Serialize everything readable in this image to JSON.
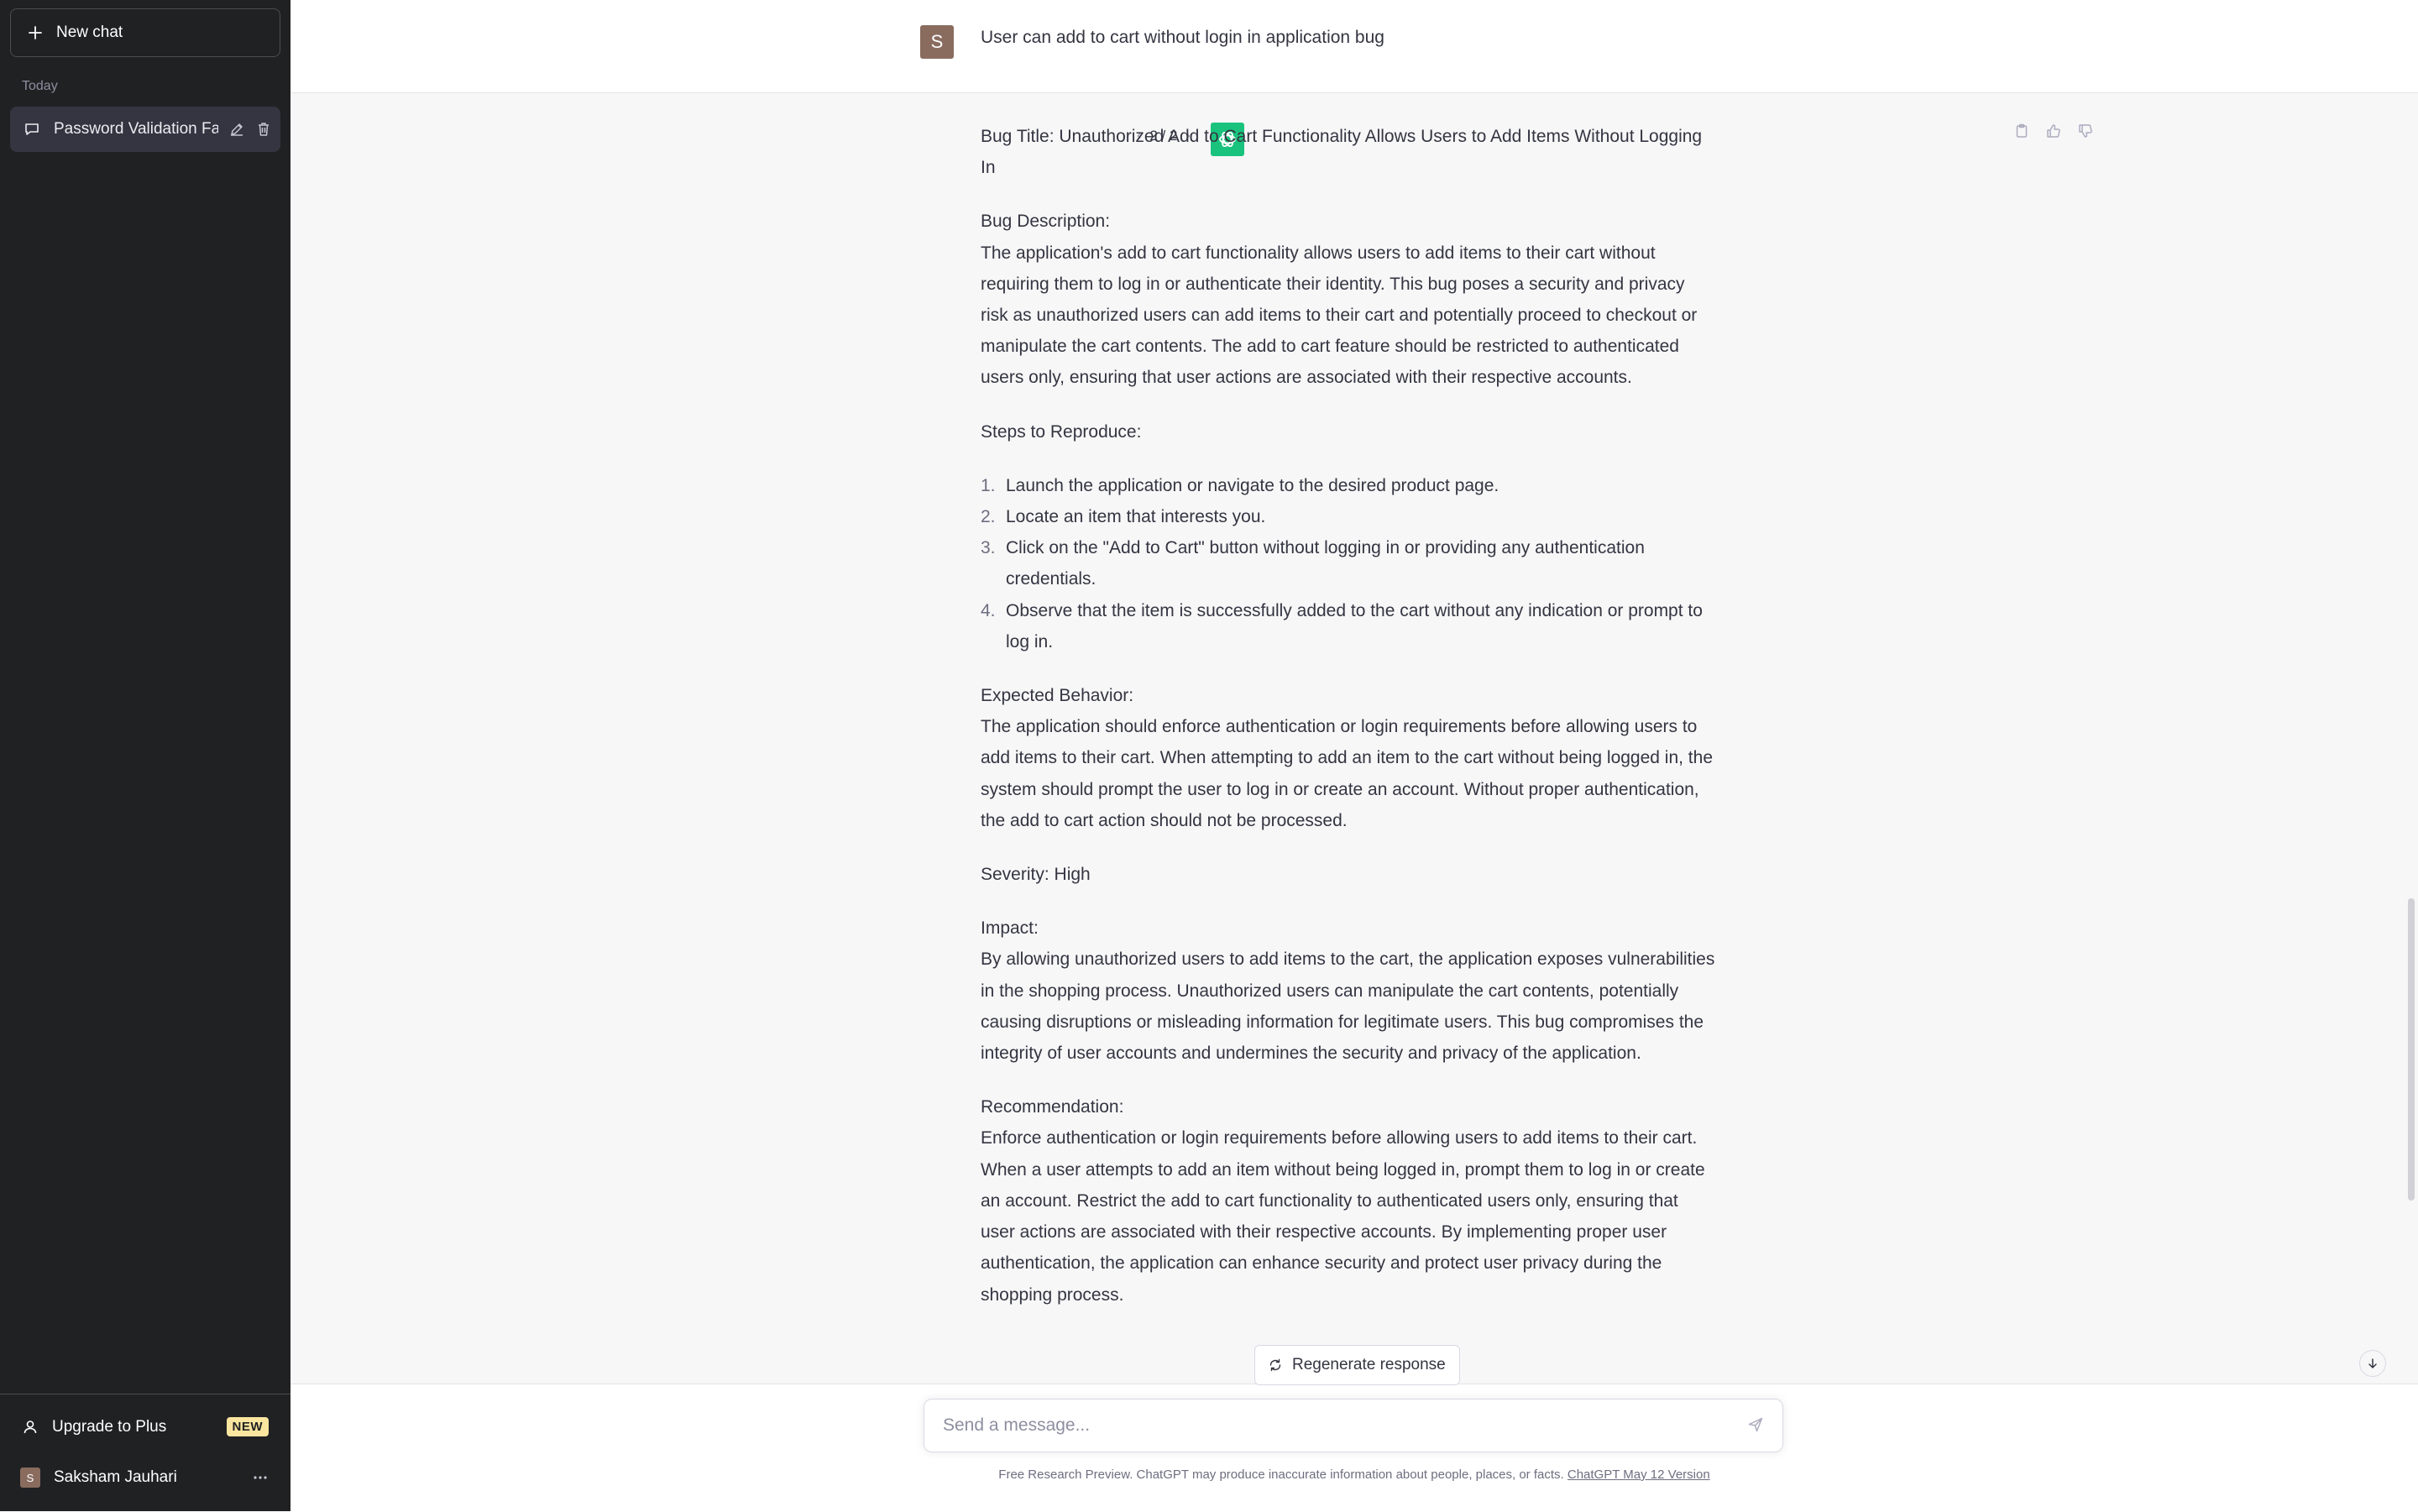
{
  "sidebar": {
    "new_chat_label": "New chat",
    "section_today": "Today",
    "chats": [
      {
        "title": "Password Validation Fai"
      }
    ],
    "upgrade_label": "Upgrade to Plus",
    "upgrade_badge": "NEW",
    "user_name": "Saksham Jauhari",
    "user_initial": "S"
  },
  "conversation": {
    "user_initial": "S",
    "user_message": "User can add to cart without login in application bug",
    "pager": "2 / 2",
    "answer": {
      "title": "Bug Title: Unauthorized Add to Cart Functionality Allows Users to Add Items Without Logging In",
      "description_heading": "Bug Description:",
      "description": "The application's add to cart functionality allows users to add items to their cart without requiring them to log in or authenticate their identity. This bug poses a security and privacy risk as unauthorized users can add items to their cart and potentially proceed to checkout or manipulate the cart contents. The add to cart feature should be restricted to authenticated users only, ensuring that user actions are associated with their respective accounts.",
      "steps_heading": "Steps to Reproduce:",
      "steps": [
        {
          "num": "1.",
          "text": "Launch the application or navigate to the desired product page."
        },
        {
          "num": "2.",
          "text": "Locate an item that interests you."
        },
        {
          "num": "3.",
          "text": "Click on the \"Add to Cart\" button without logging in or providing any authentication credentials."
        },
        {
          "num": "4.",
          "text": "Observe that the item is successfully added to the cart without any indication or prompt to log in."
        }
      ],
      "expected_heading": "Expected Behavior:",
      "expected": "The application should enforce authentication or login requirements before allowing users to add items to their cart. When attempting to add an item to the cart without being logged in, the system should prompt the user to log in or create an account. Without proper authentication, the add to cart action should not be processed.",
      "severity": "Severity: High",
      "impact_heading": "Impact:",
      "impact": "By allowing unauthorized users to add items to the cart, the application exposes vulnerabilities in the shopping process. Unauthorized users can manipulate the cart contents, potentially causing disruptions or misleading information for legitimate users. This bug compromises the integrity of user accounts and undermines the security and privacy of the application.",
      "recommendation_heading": "Recommendation:",
      "recommendation": "Enforce authentication or login requirements before allowing users to add items to their cart. When a user attempts to add an item without being logged in, prompt them to log in or create an account. Restrict the add to cart functionality to authenticated users only, ensuring that user actions are associated with their respective accounts. By implementing proper user authentication, the application can enhance security and protect user privacy during the shopping process."
    }
  },
  "regenerate_label": "Regenerate response",
  "input": {
    "placeholder": "Send a message..."
  },
  "footer": {
    "text": "Free Research Preview. ChatGPT may produce inaccurate information about people, places, or facts. ",
    "link": "ChatGPT May 12 Version"
  },
  "icons": {
    "new_chat": "plus-icon",
    "chat": "chat-bubble-icon",
    "edit": "pencil-icon",
    "delete": "trash-icon",
    "upgrade": "user-icon",
    "more": "ellipsis-icon",
    "copy": "clipboard-icon",
    "like": "thumbs-up-icon",
    "dislike": "thumbs-down-icon",
    "regenerate": "refresh-icon",
    "send": "paper-plane-icon",
    "scroll": "arrow-down-icon"
  },
  "colors": {
    "sidebar_bg": "#202123",
    "assistant_avatar": "#19c37d",
    "badge": "#fae69e",
    "user_avatar": "#8a6c5f"
  }
}
